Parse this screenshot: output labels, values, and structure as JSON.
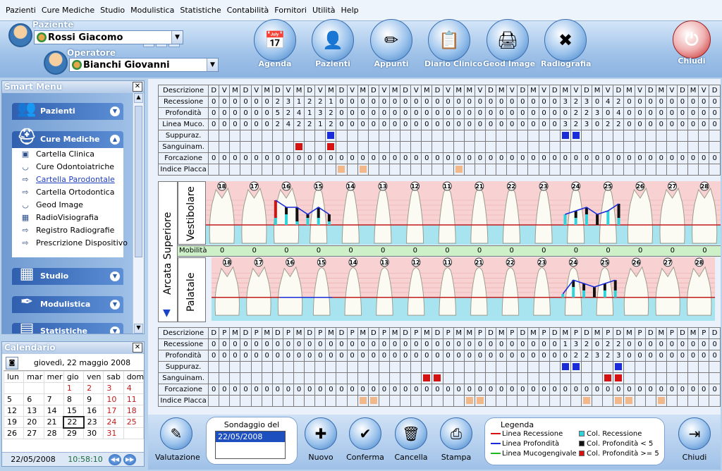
{
  "menu": [
    "Pazienti",
    "Cure Mediche",
    "Studio",
    "Modulistica",
    "Statistiche",
    "Contabilità",
    "Fornitori",
    "Utilità",
    "Help"
  ],
  "header": {
    "paziente_label": "Paziente",
    "paziente_value": "Rossi Giacomo",
    "operatore_label": "Operatore",
    "operatore_value": "Bianchi Giovanni"
  },
  "toolbar": [
    {
      "label": "Agenda",
      "icon": "agenda-icon"
    },
    {
      "label": "Pazienti",
      "icon": "patients-icon"
    },
    {
      "label": "Appunti",
      "icon": "notes-icon"
    },
    {
      "label": "Diario Clinico",
      "icon": "clipboard-icon"
    },
    {
      "label": "Geod Image",
      "icon": "scanner-icon"
    },
    {
      "label": "Radiografia",
      "icon": "xray-icon"
    }
  ],
  "close_label": "Chiudi",
  "smart_menu": {
    "title": "Smart Menu",
    "groups": [
      "Pazienti",
      "Cure Mediche",
      "Studio",
      "Modulistica",
      "Statistiche"
    ],
    "items": [
      {
        "label": "Cartella Clinica",
        "icon": "folder-icon"
      },
      {
        "label": "Cure Odontoiatriche",
        "icon": "tooth-icon"
      },
      {
        "label": "Cartella Parodontale",
        "icon": "arrow-icon",
        "active": true
      },
      {
        "label": "Cartella Ortodontica",
        "icon": "arrow-icon"
      },
      {
        "label": "Geod Image",
        "icon": "tooth-icon"
      },
      {
        "label": "RadioVisiografia",
        "icon": "xray-icon"
      },
      {
        "label": "Registro Radiografie",
        "icon": "arrow-icon"
      },
      {
        "label": "Prescrizione Dispositivo",
        "icon": "arrow-icon"
      }
    ]
  },
  "calendar": {
    "title": "Calendario",
    "header_date": "giovedì, 22 maggio 2008",
    "weekdays": [
      "lun",
      "mar",
      "mer",
      "gio",
      "ven",
      "sab",
      "dom"
    ],
    "weeks": [
      [
        "",
        "",
        "",
        "1",
        "2",
        "3",
        "4"
      ],
      [
        "5",
        "6",
        "7",
        "8",
        "9",
        "10",
        "11"
      ],
      [
        "12",
        "13",
        "14",
        "15",
        "16",
        "17",
        "18"
      ],
      [
        "19",
        "20",
        "21",
        "22",
        "23",
        "24",
        "25"
      ],
      [
        "26",
        "27",
        "28",
        "29",
        "30",
        "31",
        ""
      ]
    ],
    "today": "22",
    "footer_date": "22/05/2008",
    "footer_time": "10:58:10"
  },
  "upper": {
    "header_label": "Descrizione",
    "header": [
      "D",
      "V",
      "M",
      "D",
      "V",
      "M",
      "D",
      "V",
      "M",
      "D",
      "V",
      "M",
      "D",
      "V",
      "M",
      "D",
      "V",
      "M",
      "D",
      "V",
      "M",
      "D",
      "V",
      "M",
      "M",
      "V",
      "D",
      "M",
      "V",
      "D",
      "M",
      "V",
      "D",
      "M",
      "V",
      "D",
      "M",
      "V",
      "D",
      "M",
      "V",
      "D",
      "M",
      "V",
      "D",
      "M",
      "V",
      "D"
    ],
    "rows": [
      {
        "label": "Recessione",
        "values": [
          "0",
          "0",
          "0",
          "0",
          "0",
          "0",
          "2",
          "3",
          "1",
          "2",
          "2",
          "1",
          "0",
          "0",
          "0",
          "0",
          "0",
          "0",
          "0",
          "0",
          "0",
          "0",
          "0",
          "0",
          "0",
          "0",
          "0",
          "0",
          "0",
          "0",
          "0",
          "0",
          "0",
          "3",
          "2",
          "3",
          "0",
          "4",
          "2",
          "0",
          "0",
          "0",
          "0",
          "0",
          "0",
          "0",
          "0",
          "0"
        ]
      },
      {
        "label": "Profondità",
        "values": [
          "0",
          "0",
          "0",
          "0",
          "0",
          "0",
          "5",
          "2",
          "4",
          "1",
          "3",
          "2",
          "0",
          "0",
          "0",
          "0",
          "0",
          "0",
          "0",
          "0",
          "0",
          "0",
          "0",
          "0",
          "0",
          "0",
          "0",
          "0",
          "0",
          "0",
          "0",
          "0",
          "0",
          "0",
          "2",
          "2",
          "3",
          "0",
          "4",
          "0",
          "0",
          "0",
          "0",
          "0",
          "0",
          "0",
          "0",
          "0"
        ]
      },
      {
        "label": "Linea Muco.",
        "values": [
          "0",
          "0",
          "0",
          "0",
          "0",
          "0",
          "2",
          "4",
          "2",
          "2",
          "1",
          "2",
          "0",
          "0",
          "0",
          "0",
          "0",
          "0",
          "0",
          "0",
          "0",
          "0",
          "0",
          "0",
          "0",
          "0",
          "0",
          "0",
          "0",
          "0",
          "0",
          "0",
          "0",
          "3",
          "2",
          "3",
          "0",
          "2",
          "2",
          "0",
          "0",
          "0",
          "0",
          "0",
          "0",
          "0",
          "0",
          "0"
        ]
      },
      {
        "label": "Suppuraz.",
        "marks": {
          "11": "b",
          "33": "b",
          "34": "b"
        }
      },
      {
        "label": "Sanguinam.",
        "marks": {
          "8": "r",
          "11": "r"
        }
      },
      {
        "label": "Forcazione",
        "values": [
          "0",
          "0",
          "0",
          "0",
          "0",
          "0",
          "0",
          "0",
          "0",
          "0",
          "0",
          "0",
          "0",
          "0",
          "0",
          "0",
          "0",
          "0",
          "0",
          "0",
          "0",
          "0",
          "0",
          "0",
          "0",
          "0",
          "0",
          "0",
          "0",
          "0",
          "0",
          "0",
          "0",
          "0",
          "0",
          "0",
          "0",
          "0",
          "0",
          "0",
          "0",
          "0",
          "0",
          "0",
          "0",
          "0",
          "0",
          "0"
        ]
      },
      {
        "label": "Indice Placca",
        "marks": {
          "12": "o",
          "14": "o",
          "23": "o"
        }
      }
    ]
  },
  "tooth_numbers": [
    "18",
    "17",
    "16",
    "15",
    "14",
    "13",
    "12",
    "11",
    "21",
    "22",
    "23",
    "24",
    "25",
    "26",
    "27",
    "28"
  ],
  "arcata_label": "Arcata Superiore",
  "vestibolare_label": "Vestibolare",
  "palatale_label": "Palatale",
  "mobility_label": "Mobilità",
  "mobility": [
    "0",
    "0",
    "0",
    "0",
    "0",
    "0",
    "0",
    "0",
    "0",
    "0",
    "0",
    "0",
    "0",
    "0",
    "0",
    "0"
  ],
  "lower": {
    "header_label": "Descrizione",
    "header": [
      "D",
      "P",
      "M",
      "D",
      "P",
      "M",
      "D",
      "P",
      "M",
      "D",
      "P",
      "M",
      "D",
      "P",
      "M",
      "D",
      "P",
      "M",
      "D",
      "P",
      "M",
      "D",
      "P",
      "M",
      "M",
      "P",
      "D",
      "M",
      "P",
      "D",
      "M",
      "P",
      "D",
      "M",
      "P",
      "D",
      "M",
      "P",
      "D",
      "M",
      "P",
      "D",
      "M",
      "P",
      "D",
      "M",
      "P",
      "D"
    ],
    "rows": [
      {
        "label": "Recessione",
        "values": [
          "0",
          "0",
          "0",
          "0",
          "0",
          "0",
          "0",
          "0",
          "0",
          "0",
          "0",
          "0",
          "0",
          "0",
          "0",
          "0",
          "0",
          "0",
          "0",
          "0",
          "0",
          "0",
          "0",
          "0",
          "0",
          "0",
          "0",
          "0",
          "0",
          "0",
          "0",
          "0",
          "0",
          "1",
          "3",
          "2",
          "0",
          "2",
          "2",
          "0",
          "0",
          "0",
          "0",
          "0",
          "0",
          "0",
          "0",
          "0"
        ]
      },
      {
        "label": "Profondità",
        "values": [
          "0",
          "0",
          "0",
          "0",
          "0",
          "0",
          "0",
          "0",
          "0",
          "0",
          "0",
          "0",
          "0",
          "0",
          "0",
          "0",
          "0",
          "0",
          "0",
          "0",
          "0",
          "0",
          "0",
          "0",
          "0",
          "0",
          "0",
          "0",
          "0",
          "0",
          "0",
          "0",
          "0",
          "0",
          "2",
          "2",
          "3",
          "2",
          "3",
          "0",
          "0",
          "0",
          "0",
          "0",
          "0",
          "0",
          "0",
          "0"
        ]
      },
      {
        "label": "Suppuraz.",
        "marks": {
          "33": "b",
          "34": "b",
          "38": "b"
        }
      },
      {
        "label": "Sanguinam.",
        "marks": {
          "20": "r",
          "21": "r",
          "37": "r",
          "38": "r"
        }
      },
      {
        "label": "Forcazione",
        "values": [
          "0",
          "0",
          "0",
          "0",
          "0",
          "0",
          "0",
          "0",
          "0",
          "0",
          "0",
          "0",
          "0",
          "0",
          "0",
          "0",
          "0",
          "0",
          "0",
          "0",
          "0",
          "0",
          "0",
          "0",
          "0",
          "0",
          "0",
          "0",
          "0",
          "0",
          "0",
          "0",
          "0",
          "0",
          "0",
          "0",
          "0",
          "0",
          "0",
          "0",
          "0",
          "0",
          "0",
          "0",
          "0",
          "0",
          "0",
          "0"
        ]
      },
      {
        "label": "Indice Placca",
        "marks": {
          "14": "o",
          "15": "o",
          "24": "o",
          "25": "o",
          "35": "o",
          "38": "o",
          "39": "o",
          "42": "o"
        }
      }
    ]
  },
  "bottom": {
    "valutazione": "Valutazione",
    "sondaggio_label": "Sondaggio del",
    "sondaggio_value": "22/05/2008",
    "nuovo": "Nuovo",
    "conferma": "Conferma",
    "cancella": "Cancella",
    "stampa": "Stampa",
    "chiudi": "Chiudi"
  },
  "legend": {
    "title": "Legenda",
    "items": [
      {
        "label": "Linea Recessione",
        "color": "#d41212",
        "kind": "line"
      },
      {
        "label": "Linea Profondità",
        "color": "#1a2cd8",
        "kind": "line"
      },
      {
        "label": "Linea Mucogengivale",
        "color": "#1fb81f",
        "kind": "line"
      },
      {
        "label": "Col. Recessione",
        "color": "#2ed3dc",
        "kind": "box"
      },
      {
        "label": "Col. Profondità < 5",
        "color": "#111111",
        "kind": "box"
      },
      {
        "label": "Col. Profondità >= 5",
        "color": "#d41212",
        "kind": "box"
      }
    ]
  }
}
